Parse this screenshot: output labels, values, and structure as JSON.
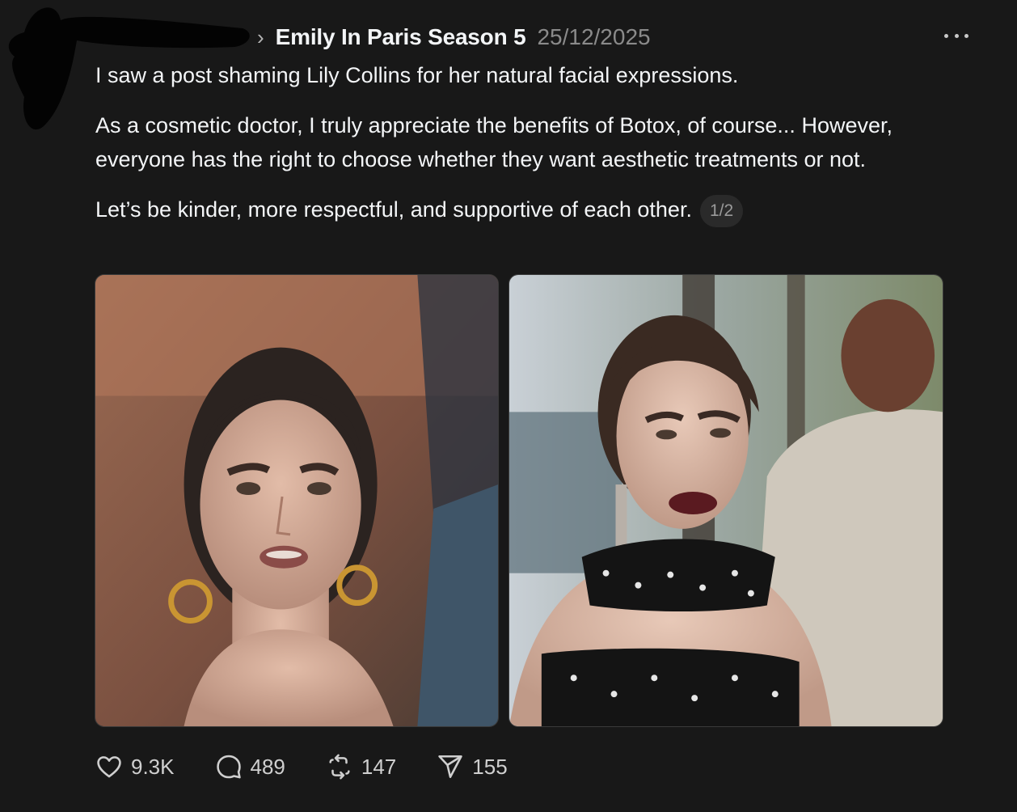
{
  "header": {
    "topic": "Emily In Paris Season 5",
    "date": "25/12/2025",
    "chevron_icon": "chevron-right-icon",
    "more_icon": "more-horizontal-icon"
  },
  "post": {
    "paragraphs": [
      "I saw a post shaming Lily Collins for her natural facial expressions.",
      "As a cosmetic doctor, I truly appreciate the benefits of Botox, of course... However, everyone has the right to choose whether they want aesthetic treatments or not.",
      "Let’s be kinder, more respectful, and supportive of each other."
    ],
    "thread_counter": "1/2"
  },
  "actions": {
    "likes": "9.3K",
    "replies": "489",
    "reposts": "147",
    "shares": "155"
  },
  "colors": {
    "background": "#181818",
    "text": "#f3f5f7",
    "muted": "#8a8a8a"
  }
}
